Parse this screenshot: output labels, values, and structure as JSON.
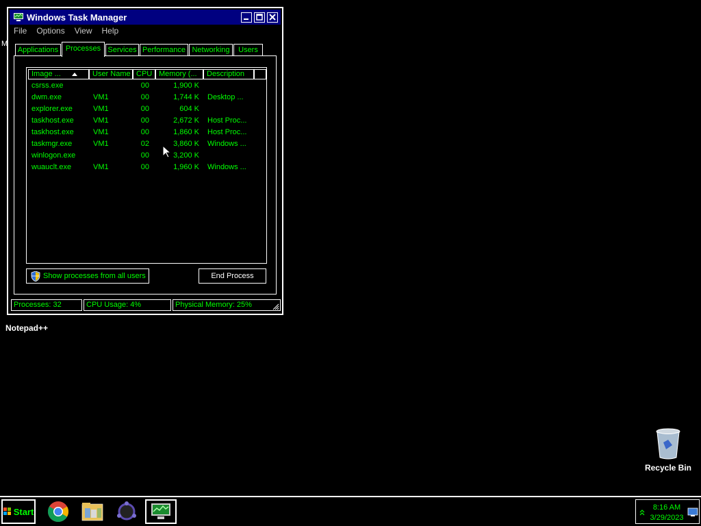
{
  "window": {
    "title": "Windows Task Manager",
    "menu": [
      "File",
      "Options",
      "View",
      "Help"
    ],
    "tabs": [
      "Applications",
      "Processes",
      "Services",
      "Performance",
      "Networking",
      "Users"
    ],
    "active_tab": "Processes"
  },
  "process_table": {
    "columns": [
      "Image ...",
      "User Name",
      "CPU",
      "Memory (...",
      "Description"
    ],
    "sort_column": "Image ...",
    "sort_direction": "ascending",
    "rows": [
      {
        "image": "csrss.exe",
        "user": "",
        "cpu": "00",
        "memory": "1,900 K",
        "description": ""
      },
      {
        "image": "dwm.exe",
        "user": "VM1",
        "cpu": "00",
        "memory": "1,744 K",
        "description": "Desktop ..."
      },
      {
        "image": "explorer.exe",
        "user": "VM1",
        "cpu": "00",
        "memory": "604 K",
        "description": ""
      },
      {
        "image": "taskhost.exe",
        "user": "VM1",
        "cpu": "00",
        "memory": "2,672 K",
        "description": "Host Proc..."
      },
      {
        "image": "taskhost.exe",
        "user": "VM1",
        "cpu": "00",
        "memory": "1,860 K",
        "description": "Host Proc..."
      },
      {
        "image": "taskmgr.exe",
        "user": "VM1",
        "cpu": "02",
        "memory": "3,860 K",
        "description": "Windows ..."
      },
      {
        "image": "winlogon.exe",
        "user": "",
        "cpu": "00",
        "memory": "3,200 K",
        "description": ""
      },
      {
        "image": "wuauclt.exe",
        "user": "VM1",
        "cpu": "00",
        "memory": "1,960 K",
        "description": "Windows ..."
      }
    ]
  },
  "buttons": {
    "show_all": "Show processes from all users",
    "end_process": "End Process"
  },
  "status": {
    "processes": "Processes: 32",
    "cpu": "CPU Usage: 4%",
    "memory": "Physical Memory: 25%"
  },
  "desktop": {
    "notepad_label": "Notepad++",
    "recycle_label": "Recycle Bin",
    "partial_label": "M"
  },
  "taskbar": {
    "start_label": "Start",
    "apps": [
      "chrome-icon",
      "file-explorer-icon",
      "network-app-icon",
      "task-manager-icon"
    ],
    "clock_time": "8:16 AM",
    "clock_date": "3/29/2023"
  },
  "colors": {
    "accent_text": "#00ff00",
    "titlebar": "#000080",
    "background": "#000000",
    "border": "#ffffff"
  }
}
